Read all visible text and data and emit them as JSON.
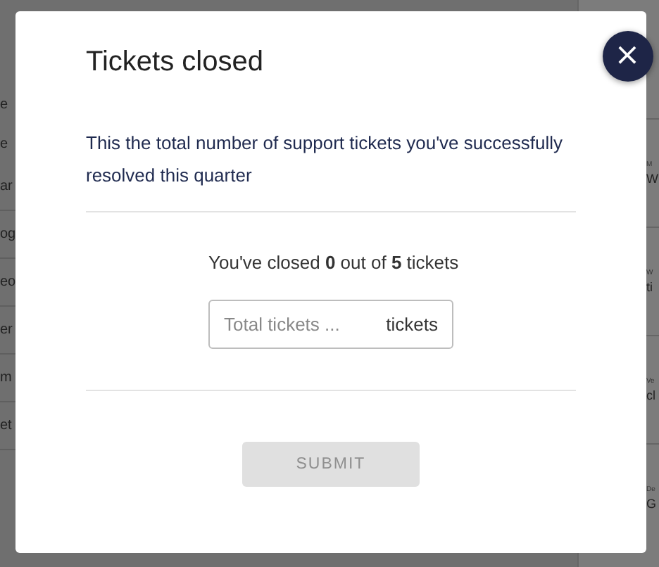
{
  "background": {
    "left_rows": [
      "e",
      "e",
      "ar",
      "og",
      "eo",
      "er",
      "m",
      "et"
    ],
    "right_rows": [
      {
        "label": "M",
        "value": "W"
      },
      {
        "label": "W",
        "value": "ti"
      },
      {
        "label": "Ve",
        "value": "cl"
      },
      {
        "label": "De",
        "value": "G"
      }
    ]
  },
  "dialog": {
    "title": "Tickets closed",
    "close": "×",
    "description": "This the total number of support tickets you've successfully resolved this quarter",
    "progress": "You've closed **0** out of **5** tickets",
    "field": {
      "placeholder": "Total tickets ...",
      "suffix": "tickets"
    },
    "submit": {
      "label": "SUBMIT",
      "disabled": true
    }
  }
}
